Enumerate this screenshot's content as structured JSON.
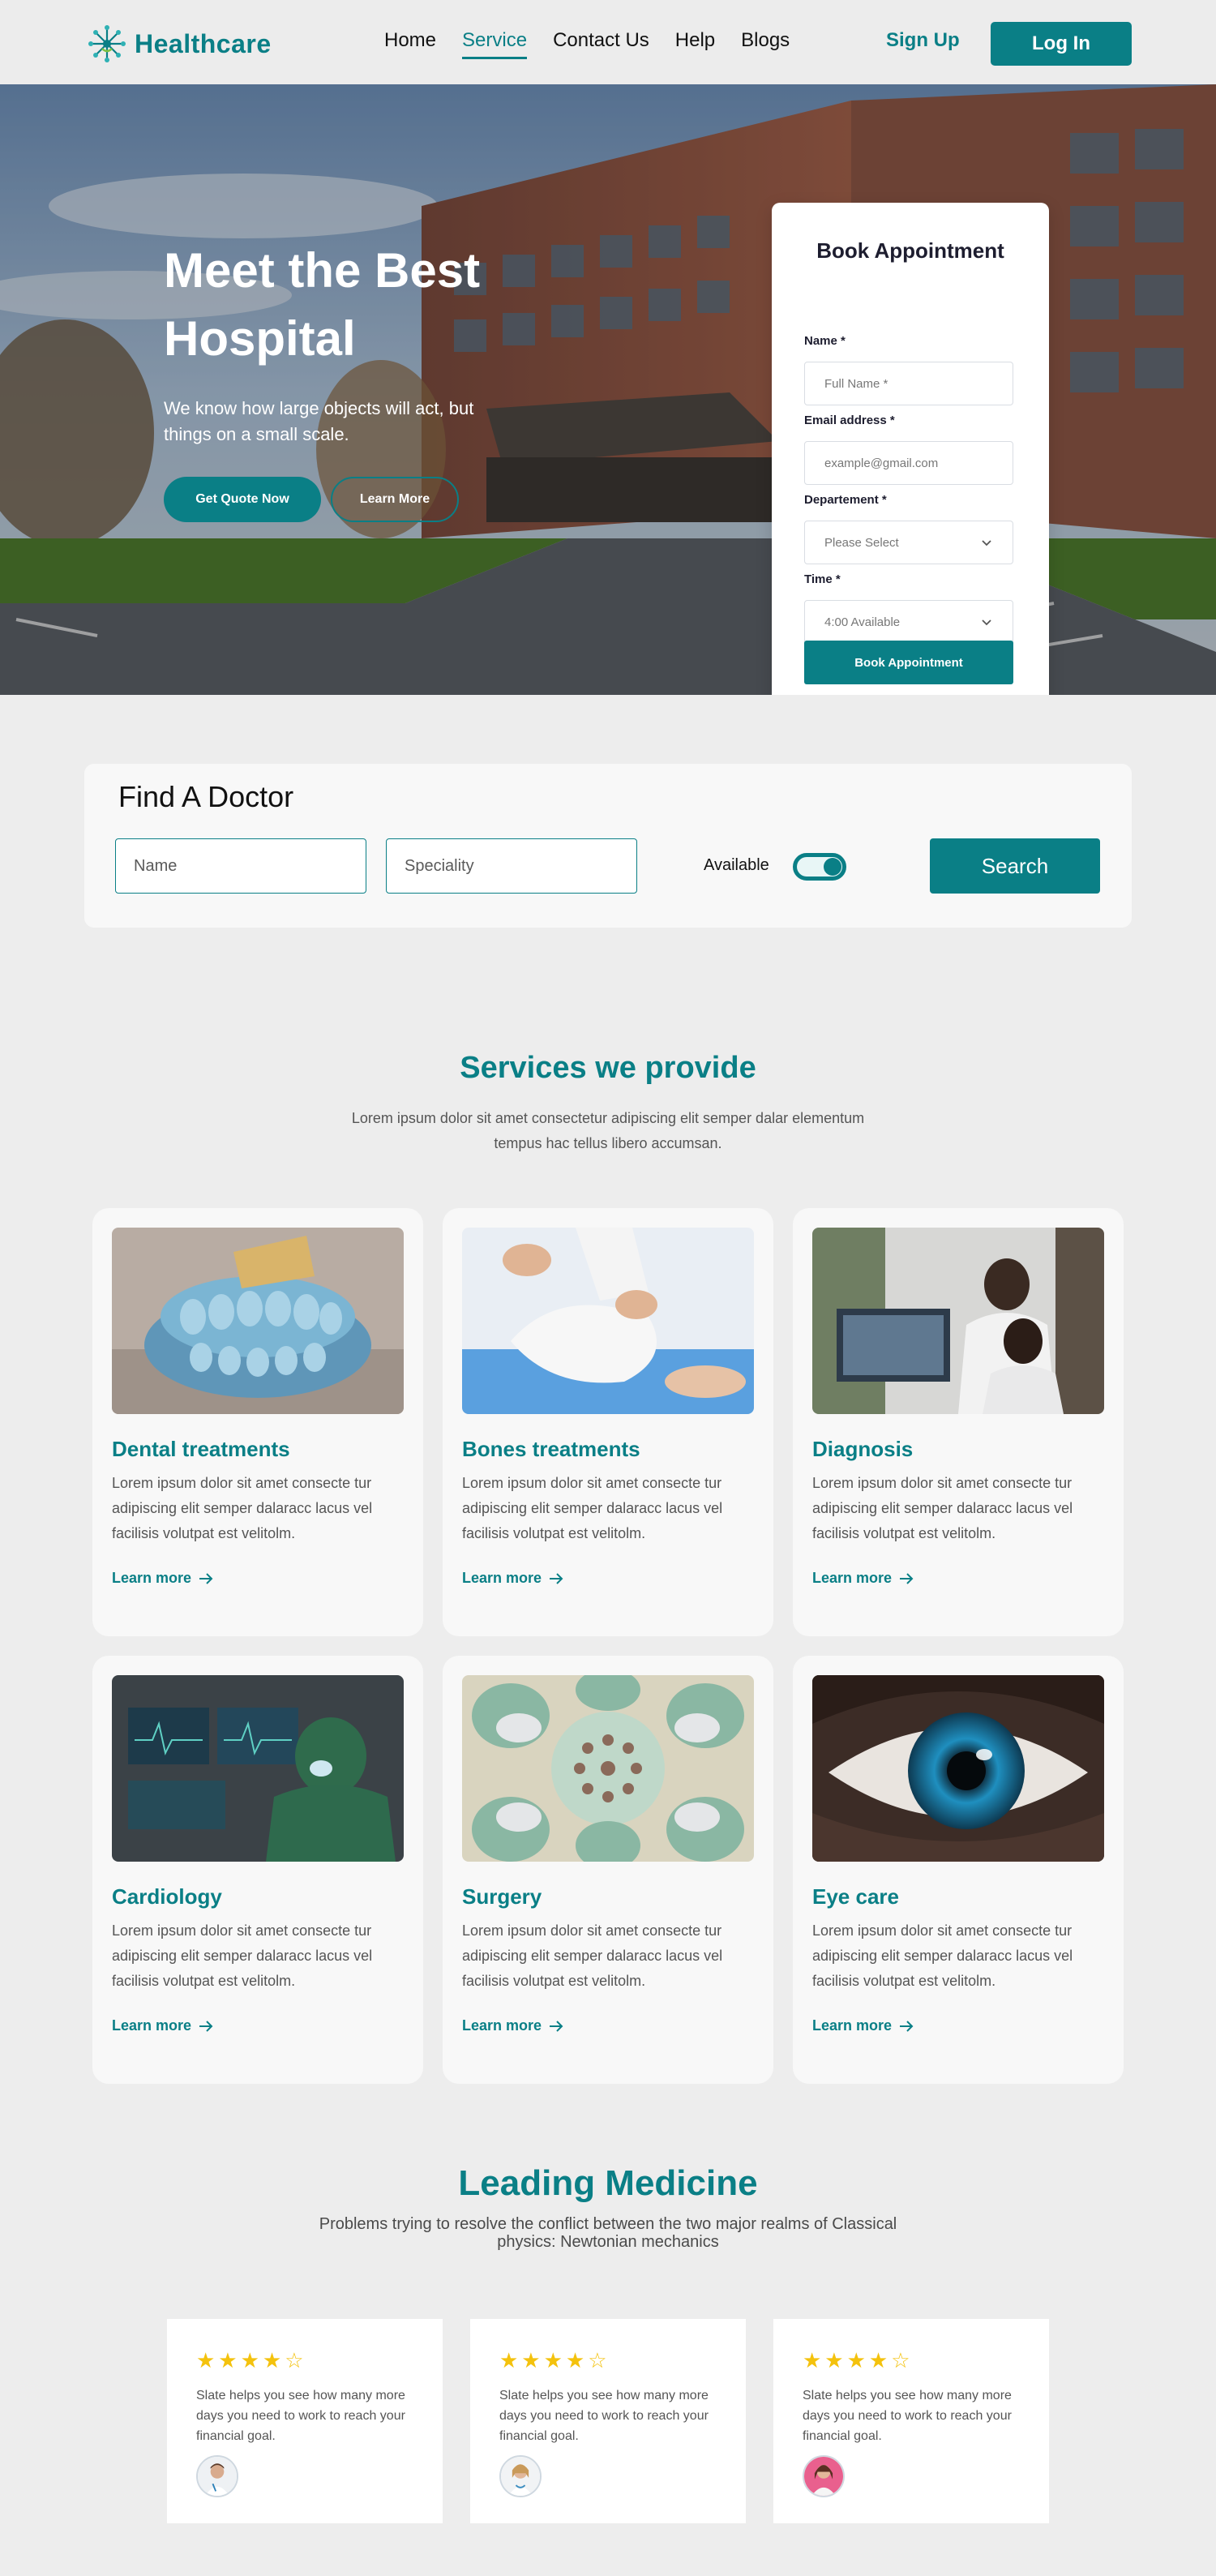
{
  "nav": {
    "brand": "Healthcare",
    "links": [
      "Home",
      "Service",
      "Contact Us",
      "Help",
      "Blogs"
    ],
    "active_link": "Service",
    "signup": "Sign Up",
    "login": "Log In"
  },
  "hero": {
    "title": "Meet the Best Hospital",
    "subtitle": "We know how large objects will act, but things on a small scale.",
    "primary_button": "Get Quote Now",
    "secondary_button": "Learn More"
  },
  "booking": {
    "title": "Book Appointment",
    "name_label": "Name *",
    "name_placeholder": "Full Name *",
    "email_label": "Email address *",
    "email_placeholder": "example@gmail.com",
    "department_label": "Departement *",
    "department_value": "Please Select",
    "time_label": "Time *",
    "time_value": "4:00 Available",
    "submit": "Book Appointment"
  },
  "find_doctor": {
    "title": "Find A Doctor",
    "name_placeholder": "Name",
    "speciality_placeholder": "Speciality",
    "available_label": "Available",
    "available_on": true,
    "search_button": "Search"
  },
  "services": {
    "title": "Services we provide",
    "subtitle": "Lorem ipsum dolor sit amet consectetur adipiscing elit semper dalar elementum tempus hac tellus libero accumsan.",
    "items": [
      {
        "title": "Dental treatments",
        "text": "Lorem ipsum dolor sit amet consecte tur adipiscing elit semper dalaracc lacus vel facilisis volutpat est velitolm.",
        "link": "Learn more"
      },
      {
        "title": "Bones treatments",
        "text": "Lorem ipsum dolor sit amet consecte tur adipiscing elit semper dalaracc lacus vel facilisis volutpat est velitolm.",
        "link": "Learn more"
      },
      {
        "title": "Diagnosis",
        "text": "Lorem ipsum dolor sit amet consecte tur adipiscing elit semper dalaracc lacus vel facilisis volutpat est velitolm.",
        "link": "Learn more"
      },
      {
        "title": "Cardiology",
        "text": "Lorem ipsum dolor sit amet consecte tur adipiscing elit semper dalaracc lacus vel facilisis volutpat est velitolm.",
        "link": "Learn more"
      },
      {
        "title": "Surgery",
        "text": "Lorem ipsum dolor sit amet consecte tur adipiscing elit semper dalaracc lacus vel facilisis volutpat est velitolm.",
        "link": "Learn more"
      },
      {
        "title": "Eye care",
        "text": "Lorem ipsum dolor sit amet consecte tur adipiscing elit semper dalaracc lacus vel facilisis volutpat est velitolm.",
        "link": "Learn more"
      }
    ]
  },
  "leading": {
    "title": "Leading Medicine",
    "subtitle": "Problems trying to resolve the conflict between the two major realms of Classical physics: Newtonian mechanics",
    "testimonials": [
      {
        "stars": "★★★★☆",
        "rating": 4,
        "text": "Slate helps you see how many more days you need to work to reach your financial goal."
      },
      {
        "stars": "★★★★☆",
        "rating": 4,
        "text": "Slate helps you see how many more days you need to work to reach your financial goal."
      },
      {
        "stars": "★★★★☆",
        "rating": 4,
        "text": "Slate helps you see how many more days you need to work to reach your financial goal."
      }
    ]
  },
  "colors": {
    "brand": "#0a7f86",
    "star": "#f4c20d",
    "page_bg": "#ededed"
  },
  "icons": [
    "logo-mark-icon",
    "chevron-down-icon",
    "arrow-right-icon",
    "star-icon"
  ]
}
